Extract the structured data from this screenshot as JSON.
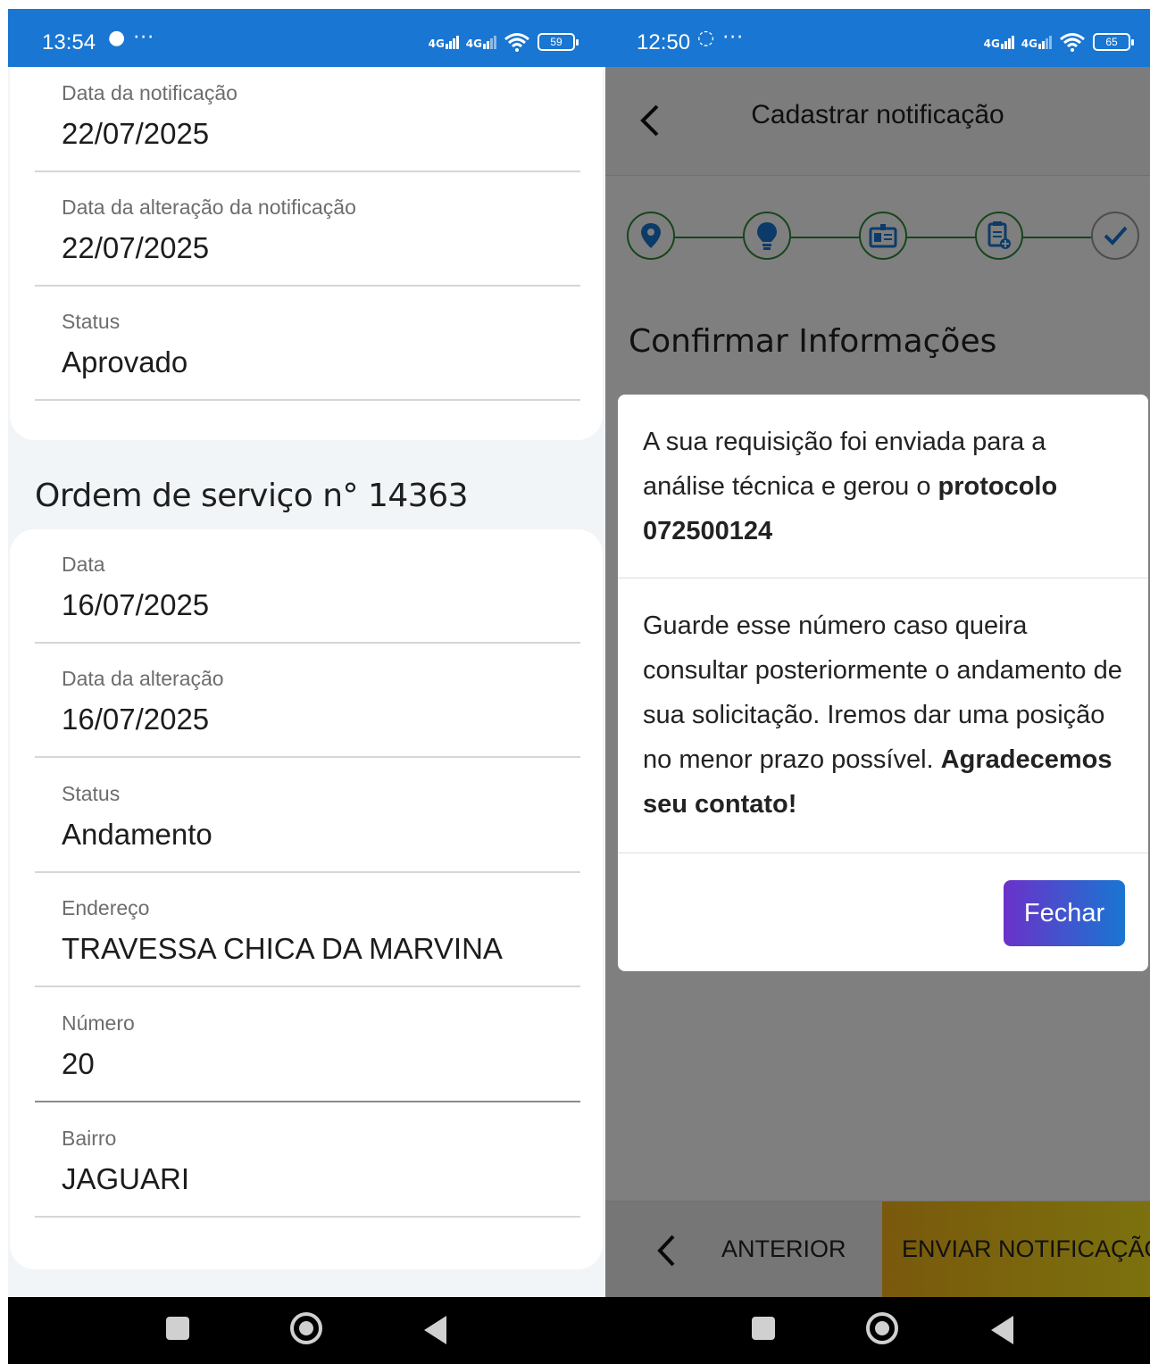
{
  "left": {
    "statusbar": {
      "time": "13:54",
      "extra": "●  ···",
      "battery": "59"
    },
    "notification_fields": [
      {
        "label": "Data da notificação",
        "value": "22/07/2025"
      },
      {
        "label": "Data da alteração da notificação",
        "value": "22/07/2025"
      },
      {
        "label": "Status",
        "value": "Aprovado"
      }
    ],
    "section_title": "Ordem de serviço n° 14363",
    "os_fields": [
      {
        "label": "Data",
        "value": "16/07/2025"
      },
      {
        "label": "Data da alteração",
        "value": "16/07/2025"
      },
      {
        "label": "Status",
        "value": "Andamento"
      },
      {
        "label": "Endereço",
        "value": "TRAVESSA CHICA DA MARVINA"
      },
      {
        "label": "Número",
        "value": "20"
      },
      {
        "label": "Bairro",
        "value": "JAGUARI"
      }
    ]
  },
  "right": {
    "statusbar": {
      "time": "12:50",
      "extra": "◌ ···",
      "battery": "65"
    },
    "header_title": "Cadastrar notificação",
    "steps": [
      "location-pin-icon",
      "lightbulb-icon",
      "id-card-icon",
      "clipboard-add-icon",
      "check-icon"
    ],
    "section_title": "Confirmar Informações",
    "modal": {
      "line1": "A sua requisição foi enviada para a análise técnica e gerou o ",
      "line1_bold": "protocolo 072500124",
      "line2": "Guarde esse número caso queira consultar posteriormente o andamento de sua solicitação. Iremos dar uma posição no menor prazo possível. ",
      "line2_bold": "Agradecemos seu contato!",
      "close_label": "Fechar"
    },
    "bottom": {
      "prev_label": "ANTERIOR",
      "send_label": "ENVIAR NOTIFICAÇÃO"
    }
  },
  "colors": {
    "primary": "#1976d2",
    "accent_purple": "#6a32c9",
    "step_green": "#2e8b3b",
    "send_yellow": "#f4b21a"
  }
}
